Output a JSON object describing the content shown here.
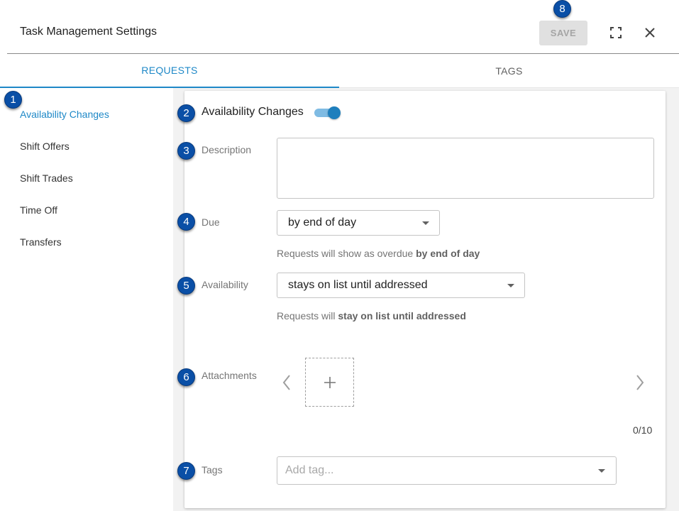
{
  "header": {
    "title": "Task Management Settings",
    "save_label": "SAVE",
    "fullscreen_icon": "fullscreen-icon",
    "close_icon": "close-icon"
  },
  "tabs": [
    {
      "label": "REQUESTS",
      "active": true
    },
    {
      "label": "TAGS",
      "active": false
    }
  ],
  "sidebar": {
    "items": [
      {
        "label": "Availability Changes",
        "active": true
      },
      {
        "label": "Shift Offers",
        "active": false
      },
      {
        "label": "Shift Trades",
        "active": false
      },
      {
        "label": "Time Off",
        "active": false
      },
      {
        "label": "Transfers",
        "active": false
      }
    ]
  },
  "form": {
    "section_title": "Availability Changes",
    "enabled": true,
    "description_label": "Description",
    "description_value": "",
    "due_label": "Due",
    "due_value": "by end of day",
    "due_hint_prefix": "Requests will show as overdue ",
    "due_hint_bold": "by end of day",
    "availability_label": "Availability",
    "availability_value": "stays on list until addressed",
    "availability_hint_prefix": "Requests will ",
    "availability_hint_bold": "stay on list until addressed",
    "attachments_label": "Attachments",
    "attachments_count": "0/10",
    "tags_label": "Tags",
    "tags_placeholder": "Add tag..."
  },
  "badges": [
    "1",
    "2",
    "3",
    "4",
    "5",
    "6",
    "7",
    "8"
  ],
  "colors": {
    "accent": "#1e88c7",
    "badge": "#0a4fa6",
    "toggle_track": "#7fbbe3",
    "toggle_thumb": "#1e7fbd",
    "save_disabled_bg": "#e0e0e0"
  }
}
